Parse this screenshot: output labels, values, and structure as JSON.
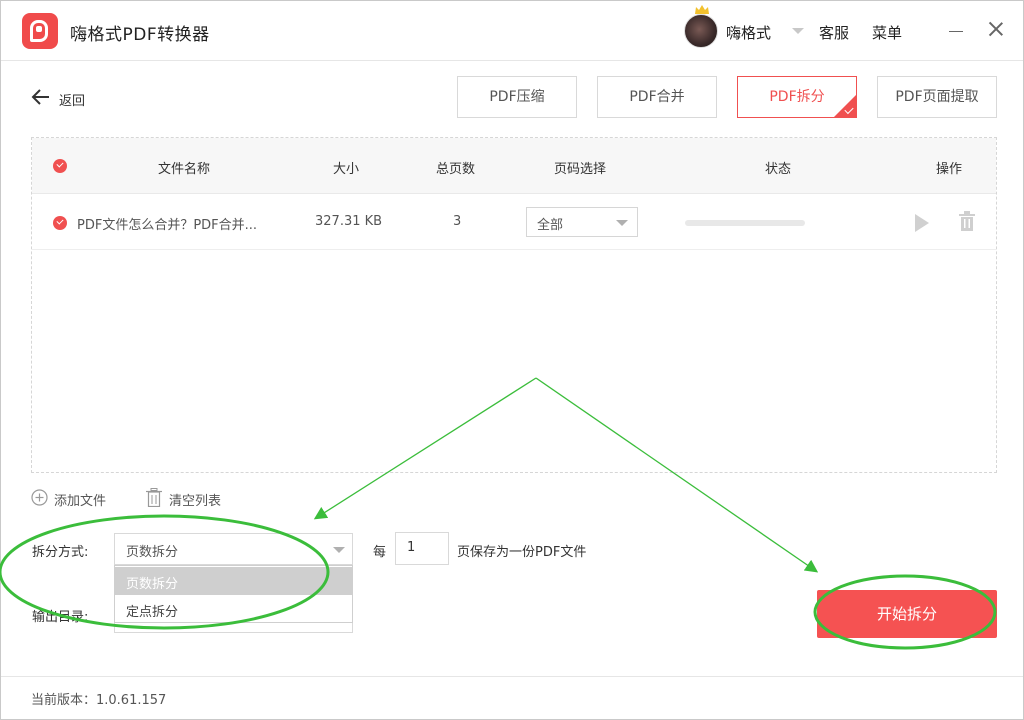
{
  "app": {
    "title": "嗨格式PDF转换器"
  },
  "user": {
    "name": "嗨格式"
  },
  "header": {
    "service": "客服",
    "menu": "菜单"
  },
  "toolbar": {
    "back_label": "返回",
    "tools": [
      {
        "label": "PDF压缩",
        "active": false
      },
      {
        "label": "PDF合并",
        "active": false
      },
      {
        "label": "PDF拆分",
        "active": true
      },
      {
        "label": "PDF页面提取",
        "active": false
      }
    ]
  },
  "table": {
    "columns": {
      "name": "文件名称",
      "size": "大小",
      "pages": "总页数",
      "page_select": "页码选择",
      "status": "状态",
      "action": "操作"
    },
    "rows": [
      {
        "name": "PDF文件怎么合并？PDF合并...",
        "size": "327.31 KB",
        "pages": "3",
        "page_select": "全部",
        "progress": 0
      }
    ]
  },
  "list_actions": {
    "add": "添加文件",
    "clear": "清空列表"
  },
  "split": {
    "mode_label": "拆分方式:",
    "mode_value": "页数拆分",
    "mode_options": [
      "页数拆分",
      "定点拆分"
    ],
    "every_label": "每",
    "every_value": "1",
    "every_suffix": "页保存为一份PDF文件",
    "output_label": "输出目录:"
  },
  "start_button": "开始拆分",
  "footer": {
    "version": "当前版本：1.0.61.157"
  },
  "colors": {
    "accent": "#f05050",
    "annotation": "#3bbd3b"
  }
}
